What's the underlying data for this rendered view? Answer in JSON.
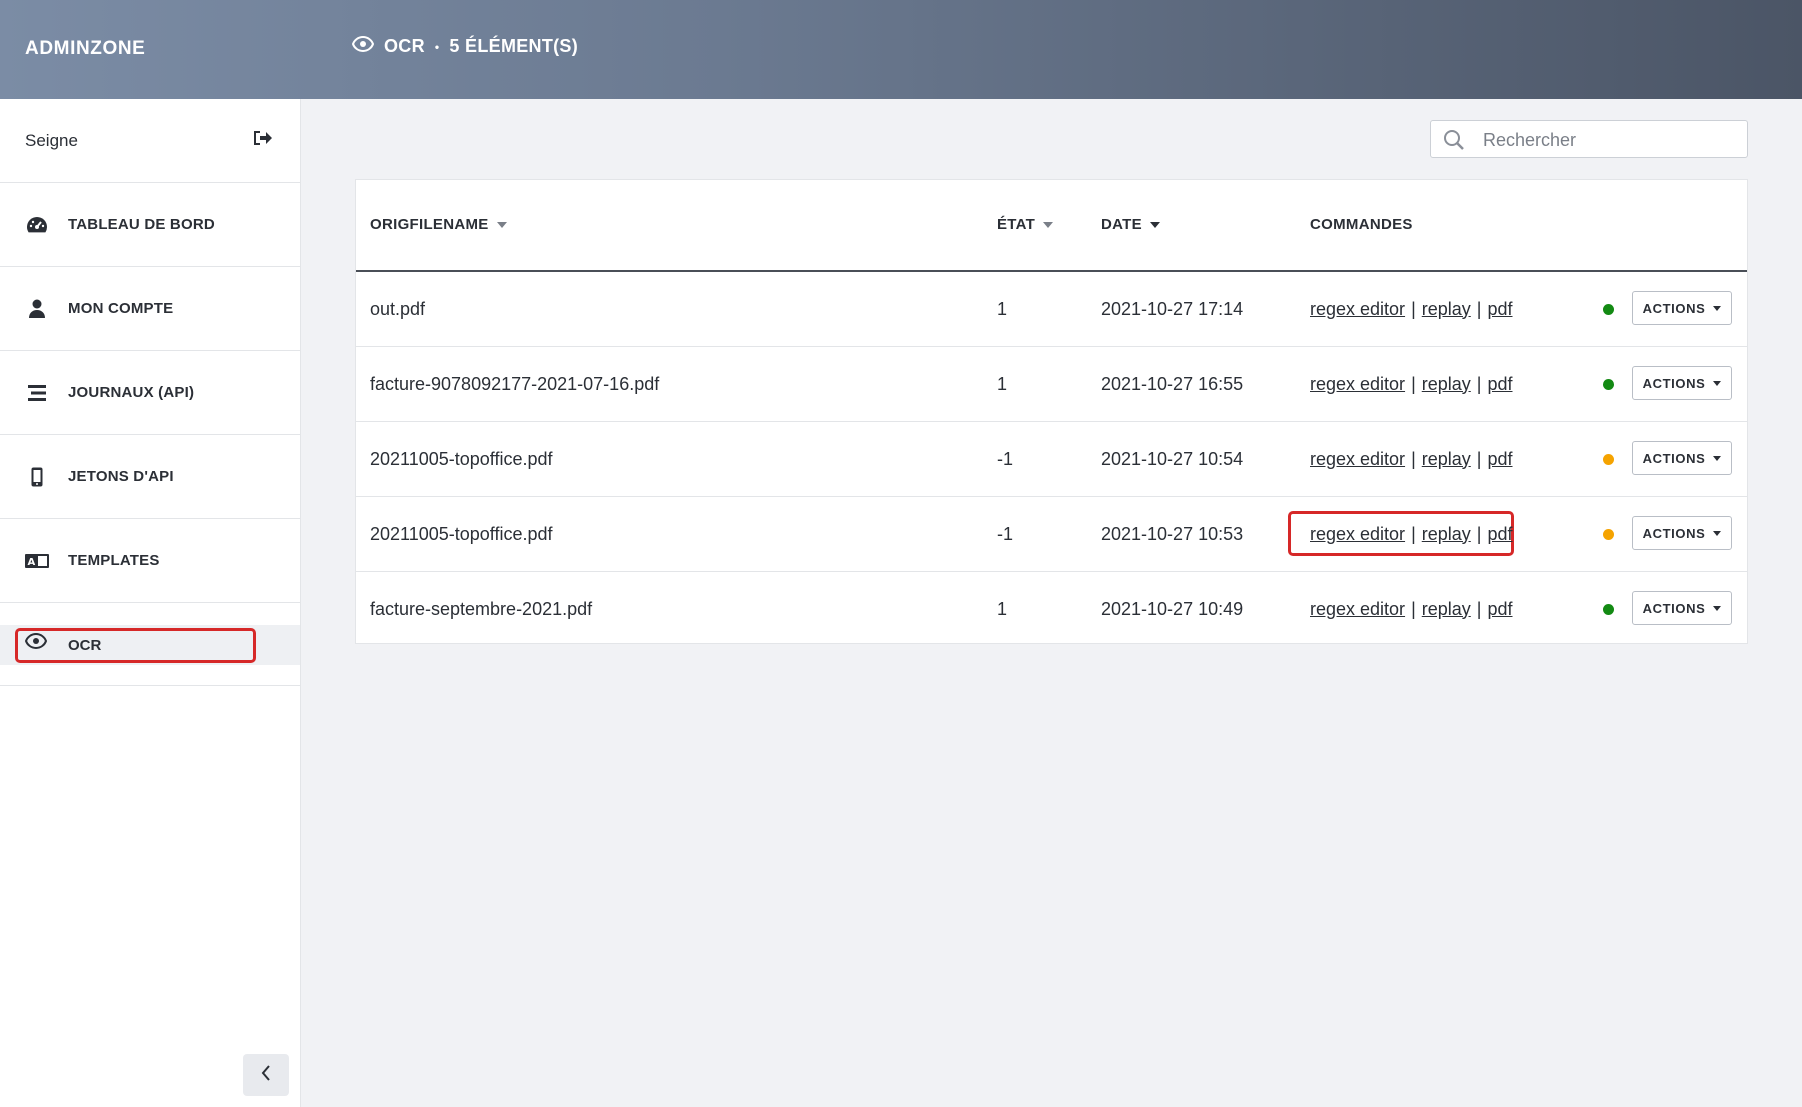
{
  "header": {
    "brand": "ADMINZONE",
    "section": "OCR",
    "separator": "•",
    "count": "5 ÉLÉMENT(S)"
  },
  "sidebar": {
    "user": "Seigne",
    "items": [
      {
        "label": "TABLEAU DE BORD",
        "icon": "dashboard-icon"
      },
      {
        "label": "MON COMPTE",
        "icon": "user-icon"
      },
      {
        "label": "JOURNAUX (API)",
        "icon": "list-icon"
      },
      {
        "label": "JETONS D'API",
        "icon": "mobile-icon"
      },
      {
        "label": "TEMPLATES",
        "icon": "translate-icon"
      },
      {
        "label": "OCR",
        "icon": "eye-icon",
        "active": true
      }
    ]
  },
  "search": {
    "placeholder": "Rechercher"
  },
  "table": {
    "columns": [
      "ORIGFILENAME",
      "ÉTAT",
      "DATE",
      "COMMANDES"
    ],
    "command_links": [
      "regex editor",
      "replay",
      "pdf"
    ],
    "command_separator": "|",
    "actions_label": "ACTIONS",
    "rows": [
      {
        "file": "out.pdf",
        "state": "1",
        "date": "2021-10-27 17:14",
        "status_color": "#138a13"
      },
      {
        "file": "facture-9078092177-2021-07-16.pdf",
        "state": "1",
        "date": "2021-10-27 16:55",
        "status_color": "#138a13"
      },
      {
        "file": "20211005-topoffice.pdf",
        "state": "-1",
        "date": "2021-10-27 10:54",
        "status_color": "#f5a300"
      },
      {
        "file": "20211005-topoffice.pdf",
        "state": "-1",
        "date": "2021-10-27 10:53",
        "status_color": "#f5a300"
      },
      {
        "file": "facture-septembre-2021.pdf",
        "state": "1",
        "date": "2021-10-27 10:49",
        "status_color": "#138a13"
      }
    ]
  },
  "colors": {
    "highlight": "#d62828",
    "status_ok": "#138a13",
    "status_warn": "#f5a300"
  }
}
